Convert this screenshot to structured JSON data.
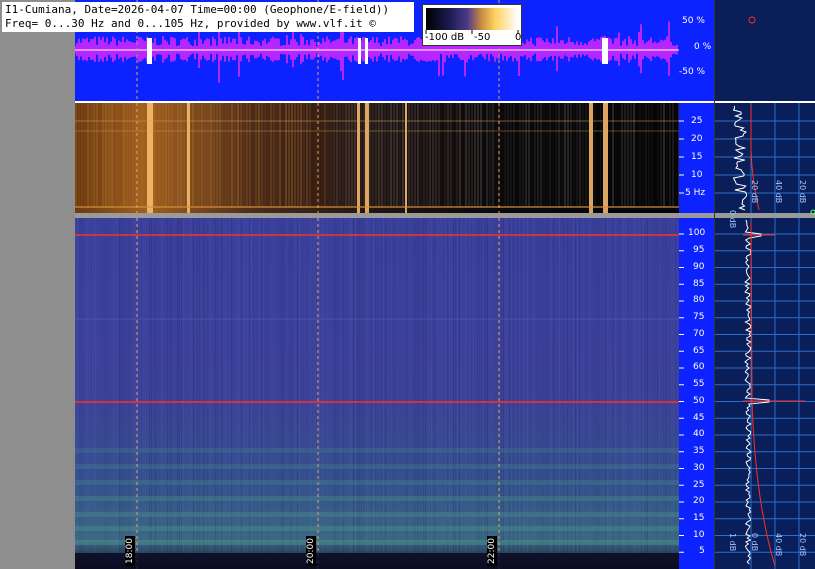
{
  "header": {
    "title_line1": "I1-Cumiana, Date=2026-04-07 Time=00:00 (Geophone/E-field))",
    "title_line2": "Freq= 0...30 Hz and 0...105 Hz, provided by www.vlf.it ©"
  },
  "colorbar": {
    "label_low": "-100 dB",
    "label_mid": "-50",
    "label_high": "0"
  },
  "waveform_axis": [
    "50 %",
    "0 %",
    "-50 %"
  ],
  "low_band_axis": [
    "25",
    "20",
    "15",
    "10",
    "5 Hz"
  ],
  "full_band_axis": [
    "100",
    "95",
    "90",
    "85",
    "80",
    "75",
    "70",
    "65",
    "60",
    "55",
    "50",
    "45",
    "40",
    "35",
    "30",
    "25",
    "20",
    "15",
    "10",
    "5"
  ],
  "time_markers": [
    "18:00",
    "20:00",
    "22:00"
  ],
  "side_panel": {
    "low_ticks": [
      "0 dB",
      "20 dB",
      "40 dB",
      "20 dB"
    ],
    "full_ticks": [
      "1 dB",
      "0 dB",
      "40 dB",
      "20 dB"
    ]
  },
  "colors": {
    "waveform_bg": "#0c22ff",
    "waveform_trace": "#ff29ff",
    "spectrogram_low": "#000000",
    "spectrogram_full": "#2c2f86",
    "marker_line": "#e6a060",
    "mains_line": "#ff3020"
  }
}
